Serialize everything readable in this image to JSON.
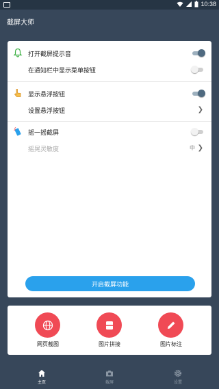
{
  "status_bar": {
    "time": "10:38"
  },
  "app": {
    "title": "截屏大师"
  },
  "settings": {
    "sections": [
      {
        "icon": "bell-icon",
        "rows": [
          {
            "label": "打开截屏提示音",
            "control": "toggle",
            "state": "on"
          },
          {
            "label": "在通知栏中显示菜单按钮",
            "control": "toggle",
            "state": "off"
          }
        ]
      },
      {
        "icon": "hand-pointer-icon",
        "rows": [
          {
            "label": "显示悬浮按钮",
            "control": "toggle",
            "state": "on"
          },
          {
            "label": "设置悬浮按钮",
            "control": "chevron"
          }
        ]
      },
      {
        "icon": "shake-phone-icon",
        "rows": [
          {
            "label": "摇一摇截屏",
            "control": "toggle",
            "state": "off"
          },
          {
            "label": "摇晃灵敏度",
            "control": "chevron",
            "value": "中",
            "disabled": true
          }
        ]
      }
    ]
  },
  "start_button": {
    "label": "开启截屏功能"
  },
  "tools": [
    {
      "label": "网页截图",
      "icon": "globe-icon"
    },
    {
      "label": "图片拼接",
      "icon": "stitch-icon"
    },
    {
      "label": "图片标注",
      "icon": "pencil-icon"
    }
  ],
  "bottom_nav": [
    {
      "label": "主页",
      "icon": "home-icon",
      "active": true
    },
    {
      "label": "截屏",
      "icon": "camera-icon",
      "active": false
    },
    {
      "label": "设置",
      "icon": "gear-icon",
      "active": false
    }
  ],
  "colors": {
    "background": "#37475a",
    "status_bar": "#263544",
    "accent_button": "#2aa1ec",
    "tool_circle": "#f04a55",
    "toggle_on": "#4f6a80"
  }
}
